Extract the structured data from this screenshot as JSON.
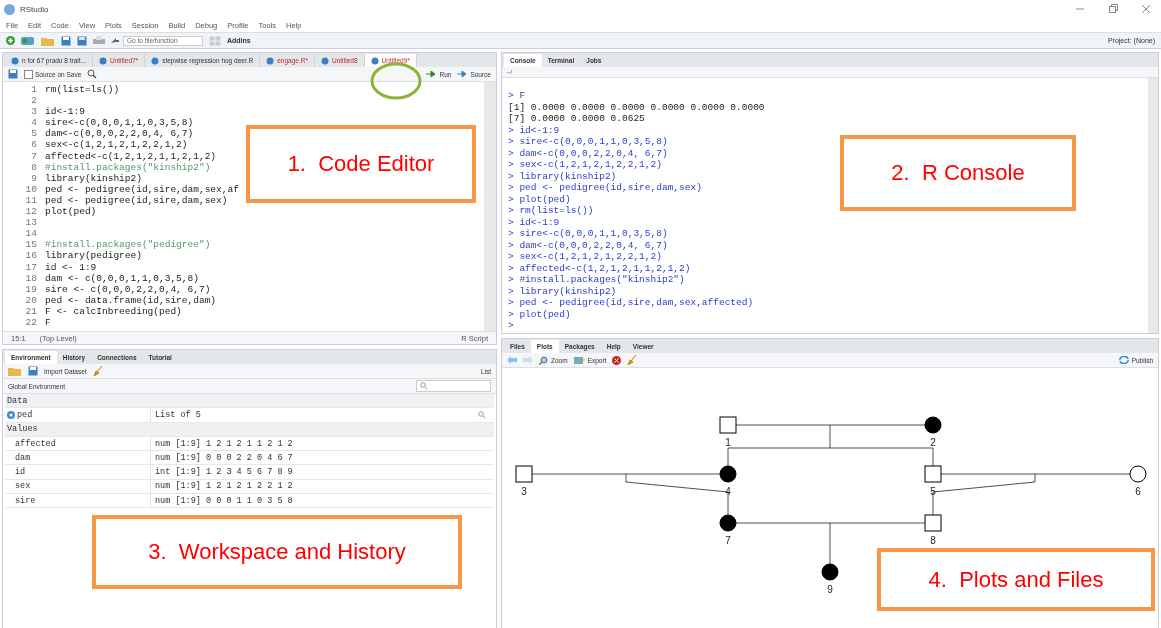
{
  "window": {
    "title": "RStudio"
  },
  "menu": [
    "File",
    "Edit",
    "Code",
    "View",
    "Plots",
    "Session",
    "Build",
    "Debug",
    "Profile",
    "Tools",
    "Help"
  ],
  "toolbar": {
    "goto_placeholder": "Go to file/function",
    "addins": "Addins",
    "project": "Project: (None)"
  },
  "editor": {
    "tabs": [
      {
        "label": "n for 67 pradu 8 trait...",
        "modified": false,
        "selected": false
      },
      {
        "label": "Untitled7*",
        "modified": true,
        "selected": false
      },
      {
        "label": "stepwise regression hog deer.R",
        "modified": false,
        "selected": false
      },
      {
        "label": "engage.R*",
        "modified": true,
        "selected": false
      },
      {
        "label": "Untitled8",
        "modified": true,
        "selected": false
      },
      {
        "label": "Untitled9*",
        "modified": true,
        "selected": true
      }
    ],
    "source_on_save": {
      "label": "Source on Save",
      "checked": false
    },
    "run": "Run",
    "source": "Source",
    "lines": [
      {
        "number": "1",
        "code": "rm(list=ls())",
        "kind": "code"
      },
      {
        "number": "2"
      },
      {
        "number": "3",
        "code": "id<-1:9",
        "kind": "code"
      },
      {
        "number": "4",
        "code": "sire<-c(0,0,0,1,1,0,3,5,8)",
        "kind": "code"
      },
      {
        "number": "5",
        "code": "dam<-c(0,0,0,2,2,0,4, 6,7)",
        "kind": "code"
      },
      {
        "number": "6",
        "code": "sex<-c(1,2,1,2,1,2,2,1,2)",
        "kind": "code"
      },
      {
        "number": "7",
        "code": "affected<-c(1,2,1,2,1,1,2,1,2)",
        "kind": "code"
      },
      {
        "number": "8",
        "code": "#install.packages(\"kinship2\")",
        "kind": "comment"
      },
      {
        "number": "9",
        "code": "library(kinship2)",
        "kind": "code"
      },
      {
        "number": "10",
        "code": "ped <- pedigree(id,sire,dam,sex,af",
        "kind": "code"
      },
      {
        "number": "11",
        "code": "ped <- pedigree(id,sire,dam,sex)",
        "kind": "code"
      },
      {
        "number": "12",
        "code": "plot(ped)",
        "kind": "code"
      },
      {
        "number": "13"
      },
      {
        "number": "14"
      },
      {
        "number": "15",
        "code": "#install.packages(\"pedigree\")",
        "kind": "comment"
      },
      {
        "number": "16",
        "code": "library(pedigree)",
        "kind": "code"
      },
      {
        "number": "17",
        "code": "id <- 1:9",
        "kind": "code"
      },
      {
        "number": "18",
        "code": "dam <- c(0,0,0,1,1,0,3,5,8)",
        "kind": "code"
      },
      {
        "number": "19",
        "code": "sire <- c(0,0,0,2,2,0,4, 6,7)",
        "kind": "code"
      },
      {
        "number": "20",
        "code": "ped <- data.frame(id,sire,dam)",
        "kind": "code"
      },
      {
        "number": "21",
        "code": "F <- calcInbreeding(ped)",
        "kind": "code"
      },
      {
        "number": "22",
        "code": "F",
        "kind": "code"
      }
    ],
    "status": {
      "position": "15:1",
      "scope": "(Top Level)",
      "type": "R Script"
    }
  },
  "console": {
    "tabs": [
      {
        "label": "Console",
        "selected": true
      },
      {
        "label": "Terminal",
        "selected": false
      },
      {
        "label": "Jobs",
        "selected": false
      }
    ],
    "path": "~/",
    "lines": [
      {
        "kind": "input",
        "text": "> F"
      },
      {
        "kind": "output",
        "text": "[1] 0.0000 0.0000 0.0000 0.0000 0.0000 0.0000"
      },
      {
        "kind": "output",
        "text": "[7] 0.0000 0.0000 0.0625"
      },
      {
        "kind": "input",
        "text": "> id<-1:9"
      },
      {
        "kind": "input",
        "text": "> sire<-c(0,0,0,1,1,0,3,5,8)"
      },
      {
        "kind": "input",
        "text": "> dam<-c(0,0,0,2,2,0,4, 6,7)"
      },
      {
        "kind": "input",
        "text": "> sex<-c(1,2,1,2,1,2,2,1,2)"
      },
      {
        "kind": "input",
        "text": "> library(kinship2)"
      },
      {
        "kind": "input",
        "text": "> ped <- pedigree(id,sire,dam,sex)"
      },
      {
        "kind": "input",
        "text": "> plot(ped)"
      },
      {
        "kind": "input",
        "text": "> rm(list=ls())"
      },
      {
        "kind": "input",
        "text": "> id<-1:9"
      },
      {
        "kind": "input",
        "text": "> sire<-c(0,0,0,1,1,0,3,5,8)"
      },
      {
        "kind": "input",
        "text": "> dam<-c(0,0,0,2,2,0,4, 6,7)"
      },
      {
        "kind": "input",
        "text": "> sex<-c(1,2,1,2,1,2,2,1,2)"
      },
      {
        "kind": "input",
        "text": "> affected<-c(1,2,1,2,1,1,2,1,2)"
      },
      {
        "kind": "input",
        "text": "> #install.packages(\"kinship2\")"
      },
      {
        "kind": "input",
        "text": "> library(kinship2)"
      },
      {
        "kind": "input",
        "text": "> ped <- pedigree(id,sire,dam,sex,affected)"
      },
      {
        "kind": "input",
        "text": "> plot(ped)"
      },
      {
        "kind": "input",
        "text": ">"
      }
    ]
  },
  "environment": {
    "tabs": [
      {
        "label": "Environment",
        "selected": true
      },
      {
        "label": "History",
        "selected": false
      },
      {
        "label": "Connections",
        "selected": false
      },
      {
        "label": "Tutorial",
        "selected": false
      }
    ],
    "import": "Import Dataset",
    "view": "List",
    "scope": "Global Environment",
    "rows": [
      {
        "kind": "section",
        "name": "Data"
      },
      {
        "kind": "data",
        "name": "ped",
        "value": "List of 5"
      },
      {
        "kind": "section",
        "name": "Values"
      },
      {
        "kind": "value",
        "name": "affected",
        "value": "num [1:9] 1 2 1 2 1 1 2 1 2"
      },
      {
        "kind": "value",
        "name": "dam",
        "value": "num [1:9] 0 0 0 2 2 0 4 6 7"
      },
      {
        "kind": "value",
        "name": "id",
        "value": "int [1:9] 1 2 3 4 5 6 7 8 9"
      },
      {
        "kind": "value",
        "name": "sex",
        "value": "num [1:9] 1 2 1 2 1 2 2 1 2"
      },
      {
        "kind": "value",
        "name": "sire",
        "value": "num [1:9] 0 0 0 1 1 0 3 5 8"
      }
    ]
  },
  "plots": {
    "tabs": [
      {
        "label": "Files",
        "selected": false
      },
      {
        "label": "Plots",
        "selected": true
      },
      {
        "label": "Packages",
        "selected": false
      },
      {
        "label": "Help",
        "selected": false
      },
      {
        "label": "Viewer",
        "selected": false
      }
    ],
    "zoom": "Zoom",
    "export": "Export",
    "publish": "Publish",
    "nodes": [
      {
        "label": "1",
        "kind": "square",
        "affected": false
      },
      {
        "label": "2",
        "kind": "circle",
        "affected": true
      },
      {
        "label": "3",
        "kind": "square",
        "affected": false
      },
      {
        "label": "4",
        "kind": "circle",
        "affected": true
      },
      {
        "label": "5",
        "kind": "square",
        "affected": false
      },
      {
        "label": "6",
        "kind": "circle",
        "affected": false
      },
      {
        "label": "7",
        "kind": "circle",
        "affected": true
      },
      {
        "label": "8",
        "kind": "square",
        "affected": false
      },
      {
        "label": "9",
        "kind": "circle",
        "affected": true
      }
    ]
  },
  "annotations": [
    {
      "text": "1.  Code Editor"
    },
    {
      "text": "2.  R Console"
    },
    {
      "text": "3.  Workspace and History"
    },
    {
      "text": "4.  Plots and Files"
    }
  ]
}
